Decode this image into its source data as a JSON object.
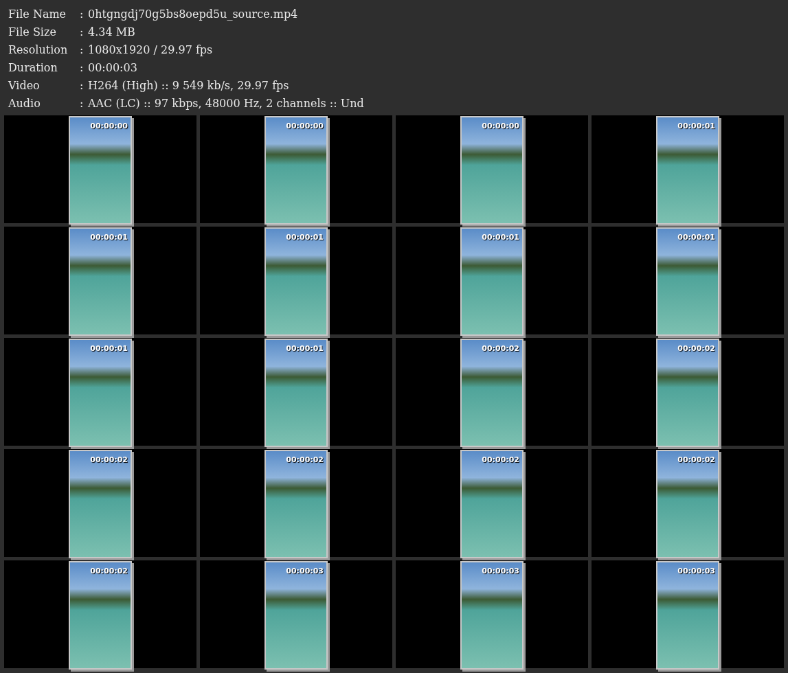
{
  "info": [
    {
      "label": "File Name",
      "value": "0htgngdj70g5bs8oepd5u_source.mp4"
    },
    {
      "label": "File Size",
      "value": "4.34 MB"
    },
    {
      "label": "Resolution",
      "value": "1080x1920 / 29.97 fps"
    },
    {
      "label": "Duration",
      "value": "00:00:03"
    },
    {
      "label": "Video",
      "value": "H264 (High) :: 9 549 kb/s, 29.97 fps"
    },
    {
      "label": "Audio",
      "value": "AAC (LC) :: 97 kbps, 48000 Hz, 2 channels :: Und"
    }
  ],
  "separator": ":",
  "thumbnails": [
    {
      "timestamp": "00:00:00"
    },
    {
      "timestamp": "00:00:00"
    },
    {
      "timestamp": "00:00:00"
    },
    {
      "timestamp": "00:00:01"
    },
    {
      "timestamp": "00:00:01"
    },
    {
      "timestamp": "00:00:01"
    },
    {
      "timestamp": "00:00:01"
    },
    {
      "timestamp": "00:00:01"
    },
    {
      "timestamp": "00:00:01"
    },
    {
      "timestamp": "00:00:01"
    },
    {
      "timestamp": "00:00:02"
    },
    {
      "timestamp": "00:00:02"
    },
    {
      "timestamp": "00:00:02"
    },
    {
      "timestamp": "00:00:02"
    },
    {
      "timestamp": "00:00:02"
    },
    {
      "timestamp": "00:00:02"
    },
    {
      "timestamp": "00:00:02"
    },
    {
      "timestamp": "00:00:03"
    },
    {
      "timestamp": "00:00:03"
    },
    {
      "timestamp": "00:00:03"
    }
  ]
}
